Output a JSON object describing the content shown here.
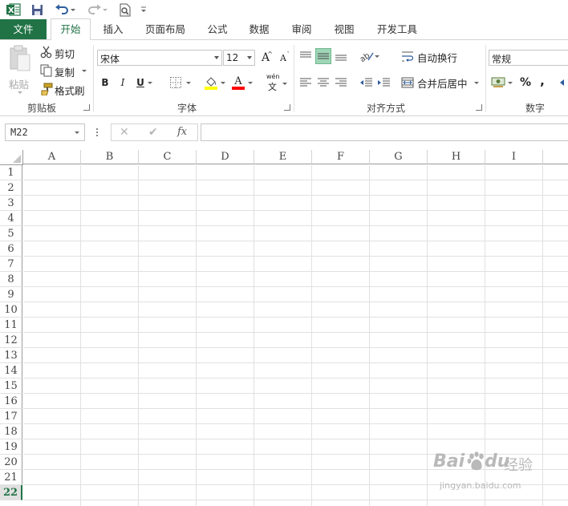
{
  "app": {
    "accent": "#217346",
    "selection_color": "#9fd5b7"
  },
  "qat": {
    "items": [
      "excel-logo",
      "save",
      "undo",
      "redo",
      "print-preview",
      "customize"
    ]
  },
  "tabs": [
    {
      "label": "文件"
    },
    {
      "label": "开始"
    },
    {
      "label": "插入"
    },
    {
      "label": "页面布局"
    },
    {
      "label": "公式"
    },
    {
      "label": "数据"
    },
    {
      "label": "审阅"
    },
    {
      "label": "视图"
    },
    {
      "label": "开发工具"
    }
  ],
  "ribbon": {
    "clipboard": {
      "paste": "粘贴",
      "cut": "剪切",
      "copy": "复制",
      "format_painter": "格式刷",
      "group": "剪贴板"
    },
    "font": {
      "name": "宋体",
      "size": "12",
      "bold": "B",
      "italic": "I",
      "underline": "U",
      "grow": "A",
      "shrink": "A",
      "font_color_letter": "A",
      "phonetic": "wén",
      "phonetic_letter": "文",
      "group": "字体"
    },
    "alignment": {
      "wrap": "自动换行",
      "merge": "合并后居中",
      "group": "对齐方式"
    },
    "number": {
      "format": "常规",
      "percent": "%",
      "comma": ",",
      "group": "数字"
    }
  },
  "formula_bar": {
    "name_box": "M22",
    "cancel": "✕",
    "enter": "✔",
    "fx": "fx",
    "value": ""
  },
  "grid": {
    "columns": [
      "A",
      "B",
      "C",
      "D",
      "E",
      "F",
      "G",
      "H",
      "I"
    ],
    "rows": [
      "1",
      "2",
      "3",
      "4",
      "5",
      "6",
      "7",
      "8",
      "9",
      "10",
      "11",
      "12",
      "13",
      "14",
      "15",
      "16",
      "17",
      "18",
      "19",
      "20",
      "21",
      "22"
    ],
    "selected_row": "22"
  },
  "watermark": {
    "brand_a": "Bai",
    "brand_b": "du",
    "brand_cn": "经验",
    "url": "jingyan.baidu.com"
  }
}
